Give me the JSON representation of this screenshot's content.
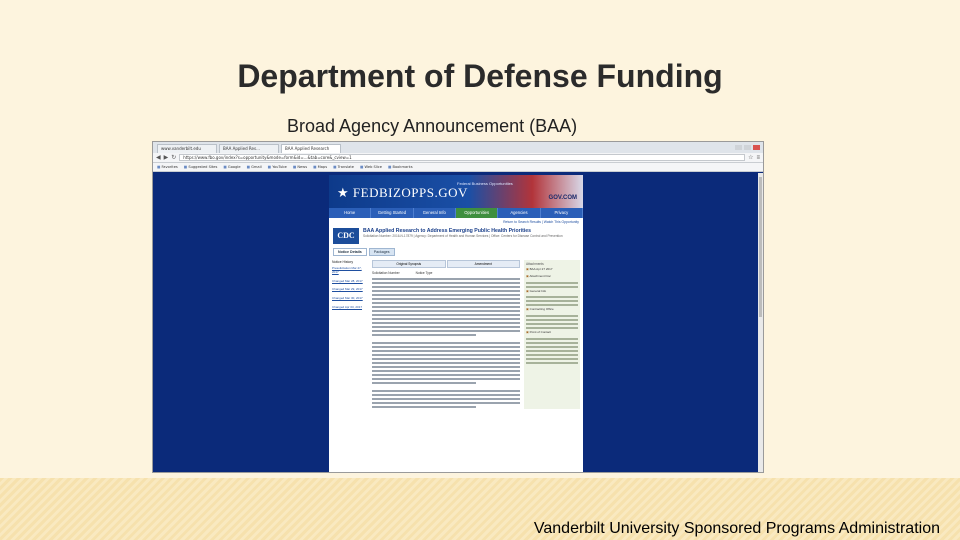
{
  "slide": {
    "title": "Department of Defense Funding",
    "subtitle": "Broad Agency Announcement (BAA)",
    "footer": "Vanderbilt University Sponsored Programs Administration"
  },
  "browser": {
    "tabs": [
      "www.vanderbilt.edu",
      "BAA Applied Res...",
      "BAA Applied Research"
    ],
    "url": "https://www.fbo.gov/index?s=opportunity&mode=form&id=...&tab=core&_cview=1",
    "bookmarks": [
      "Favorites",
      "Suggested Sites",
      "Google",
      "Gmail",
      "YouTube",
      "News",
      "Maps",
      "Translate",
      "Web Slice",
      "Bookmarks"
    ]
  },
  "fbo": {
    "logo": "★ FEDBIZOPPS.GOV",
    "tagline": "Federal Business Opportunities",
    "gov_logo": "GOV.COM",
    "nav": [
      "Home",
      "Getting Started",
      "General Info",
      "Opportunities",
      "Agencies",
      "Privacy"
    ],
    "util_links": "Return to Search Results | Watch This Opportunity",
    "cdc_logo": "CDC",
    "opp_title": "BAA Applied Research to Address Emerging Public Health Priorities",
    "opp_meta": "Solicitation Number: 2016-N-17879 | Agency: Department of Health and Human Services | Office: Centers for Disease Control and Prevention",
    "sub_tabs": [
      "Notice Details",
      "Packages"
    ],
    "history_head": "Notice History",
    "history": [
      "Presolicitation Mar 27, 2017",
      "Changed Mar 28, 2017",
      "Changed Mar 29, 2017",
      "Changed Mar 30, 2017",
      "Changed Apr 03, 2017"
    ],
    "mid_tabs": [
      "Original Synopsis",
      "Amendment"
    ],
    "kv": [
      "Solicitation Number",
      "Notice Type"
    ],
    "right_head": "Attachments",
    "right_items": [
      "BAA Apr 27 2017",
      "Attachment Doc",
      "General Info",
      "Contracting Office",
      "Point of Contact"
    ]
  }
}
